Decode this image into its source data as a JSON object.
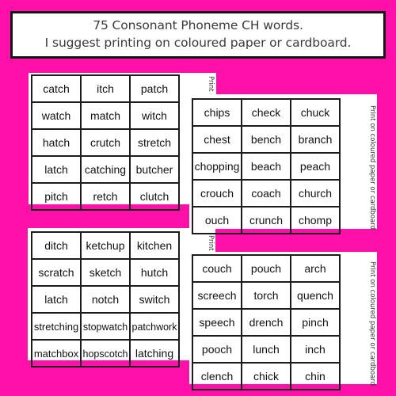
{
  "header": {
    "line1": "75 Consonant Phoneme CH words.",
    "line2": "I suggest printing on coloured paper or cardboard."
  },
  "colors": {
    "background": "#FF10A8",
    "sheet": "#FFFFFF",
    "border": "#1C1C1C",
    "header_text": "#3A3A3A"
  },
  "sheets": [
    {
      "side_note": "Print on coloured paper or cardboard",
      "rows": [
        [
          "catch",
          "itch",
          "patch"
        ],
        [
          "watch",
          "match",
          "witch"
        ],
        [
          "hatch",
          "crutch",
          "stretch"
        ],
        [
          "latch",
          "catching",
          "butcher"
        ],
        [
          "pitch",
          "retch",
          "clutch"
        ]
      ]
    },
    {
      "side_note": "Print on coloured paper or cardboard",
      "rows": [
        [
          "chips",
          "check",
          "chuck"
        ],
        [
          "chest",
          "bench",
          "branch"
        ],
        [
          "chopping",
          "beach",
          "peach"
        ],
        [
          "crouch",
          "coach",
          "church"
        ],
        [
          "ouch",
          "crunch",
          "chomp"
        ]
      ]
    },
    {
      "side_note": "Print on coloured paper or cardboard",
      "rows": [
        [
          "ditch",
          "ketchup",
          "kitchen"
        ],
        [
          "scratch",
          "sketch",
          "hutch"
        ],
        [
          "latch",
          "notch",
          "switch"
        ],
        [
          "stretching",
          "stopwatch",
          "patchwork"
        ],
        [
          "matchbox",
          "hopscotch",
          "latching"
        ]
      ]
    },
    {
      "side_note": "Print on coloured paper or cardboard",
      "rows": [
        [
          "couch",
          "pouch",
          "arch"
        ],
        [
          "screech",
          "torch",
          "quench"
        ],
        [
          "speech",
          "drench",
          "pinch"
        ],
        [
          "pooch",
          "lunch",
          "inch"
        ],
        [
          "clench",
          "chick",
          "chin"
        ]
      ]
    }
  ]
}
